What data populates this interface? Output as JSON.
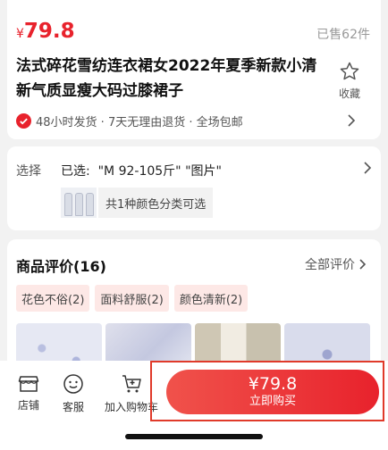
{
  "product": {
    "currency": "¥",
    "price": "79.8",
    "sold": "已售62件",
    "title": "法式碎花雪纺连衣裙女2022年夏季新款小清新气质显瘦大码过膝裙子",
    "favorite_label": "收藏",
    "service": "48小时发货 · 7天无理由退货 · 全场包邮"
  },
  "selection": {
    "label": "选择",
    "value": "已选:  \"M 92-105斤\" \"图片\"",
    "note": "共1种颜色分类可选"
  },
  "reviews": {
    "title": "商品评价(16)",
    "all_label": "全部评价",
    "tags": [
      "花色不俗(2)",
      "面料舒服(2)",
      "颜色清新(2)"
    ]
  },
  "bottom_bar": {
    "shop_label": "店铺",
    "service_label": "客服",
    "cart_label": "加入购物车",
    "buy_price": "¥79.8",
    "buy_label": "立即购买"
  },
  "colors": {
    "accent": "#e8222c",
    "tag_bg": "#fde8e6"
  },
  "icons": [
    "star-icon",
    "check-badge-icon",
    "chevron-right-icon",
    "shop-icon",
    "smile-icon",
    "cart-icon"
  ]
}
